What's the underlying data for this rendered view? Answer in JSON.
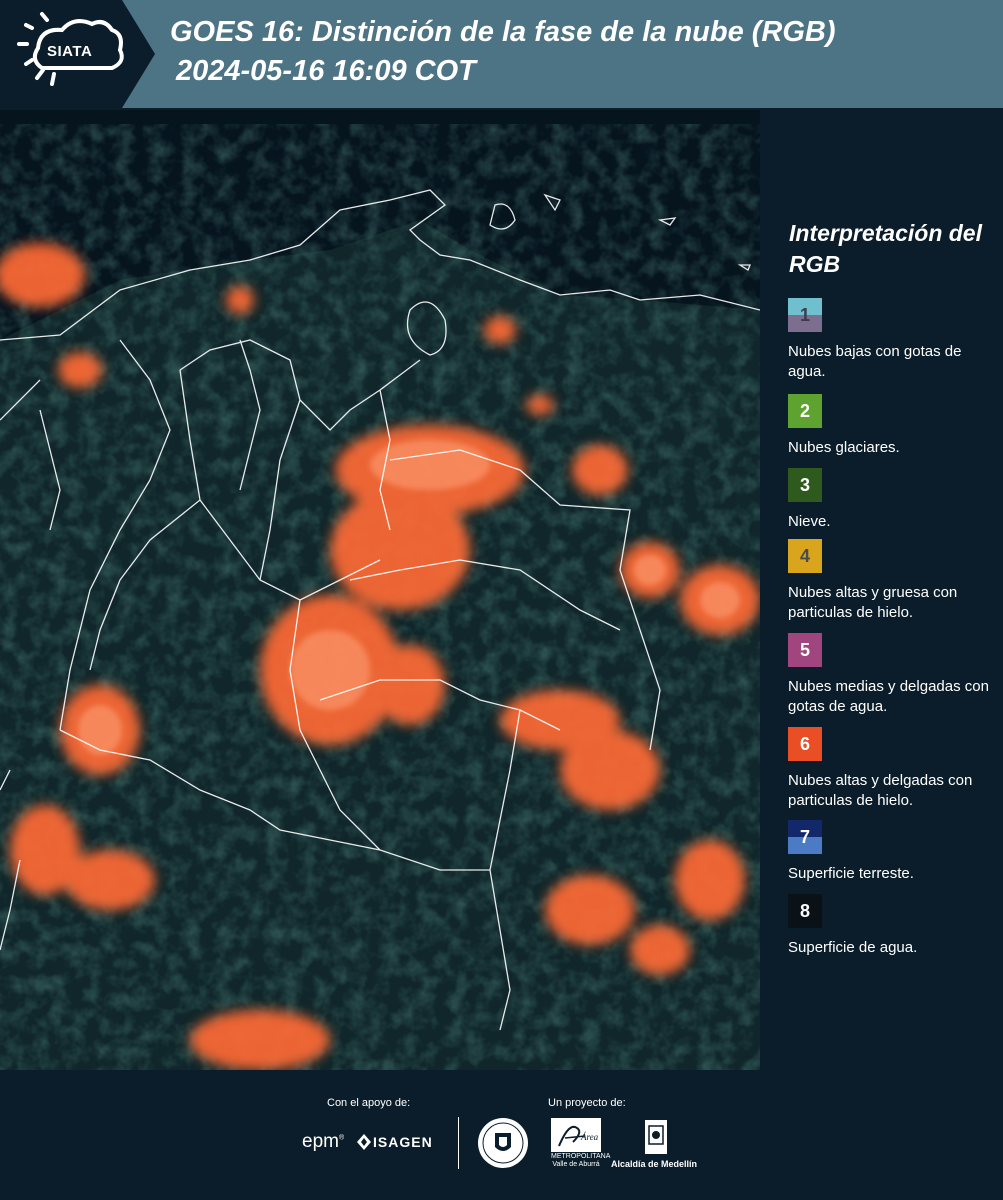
{
  "header": {
    "logo_text": "SIATA",
    "title_line1": "GOES 16: Distinción de la fase de la nube (RGB)",
    "title_line2": "2024-05-16 16:09 COT",
    "background_color": "#4d7484"
  },
  "map": {
    "description_icon": "satellite-rgb-map",
    "cloud_color": "#ff6a35",
    "water_color": "#06141e",
    "land_color": "#17332e",
    "border_color": "#ffffff"
  },
  "legend": {
    "title": "Interpretación del RGB",
    "items": [
      {
        "number": "1",
        "label": "Nubes bajas con gotas de agua.",
        "color_top": "#6fbfcf",
        "color_bottom": "#7d6d8f",
        "num_color": "#3b3b4d"
      },
      {
        "number": "2",
        "label": "Nubes glaciares.",
        "color_top": "#5ea32f",
        "color_bottom": "#5ea32f",
        "num_color": "#ffffff"
      },
      {
        "number": "3",
        "label": "Nieve.",
        "color_top": "#2f5a1d",
        "color_bottom": "#2f5a1d",
        "num_color": "#ffffff"
      },
      {
        "number": "4",
        "label": "Nubes altas y gruesa con particulas de hielo.",
        "color_top": "#d9a51c",
        "color_bottom": "#d9a51c",
        "num_color": "#4a4a4a"
      },
      {
        "number": "5",
        "label": "Nubes medias y delgadas con gotas de agua.",
        "color_top": "#a0457d",
        "color_bottom": "#a0457d",
        "num_color": "#ffffff"
      },
      {
        "number": "6",
        "label": "Nubes altas y delgadas con particulas de hielo.",
        "color_top": "#e94e24",
        "color_bottom": "#e94e24",
        "num_color": "#ffffff"
      },
      {
        "number": "7",
        "label": "Superficie terreste.",
        "color_top": "#13286b",
        "color_bottom": "#4a7bc4",
        "num_color": "#ffffff"
      },
      {
        "number": "8",
        "label": "Superficie de agua.",
        "color_top": "#0a1218",
        "color_bottom": "#0a1218",
        "num_color": "#ffffff"
      }
    ]
  },
  "footer": {
    "support_label": "Con el apoyo de:",
    "project_label": "Un proyecto de:",
    "sponsor_1": "epm",
    "sponsor_2": "ISAGEN",
    "partner_1_text": "METROPOLITANA Valle de Aburrá",
    "partner_1_logo": "Área",
    "partner_2": "Alcaldía de Medellín"
  }
}
